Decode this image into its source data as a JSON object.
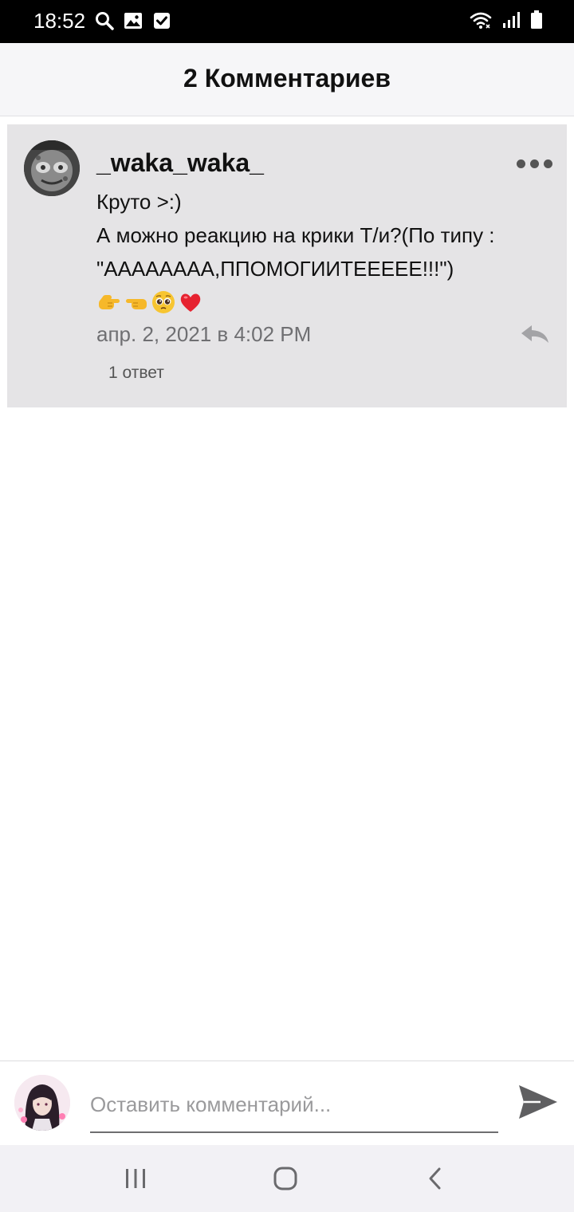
{
  "status_bar": {
    "time": "18:52",
    "left_icons": [
      "search-icon",
      "image-icon",
      "checkbox-icon"
    ],
    "right_icons": [
      "wifi-icon",
      "signal-icon",
      "battery-icon"
    ]
  },
  "header": {
    "title": "2 Комментариев"
  },
  "comments": [
    {
      "username": "_waka_waka_",
      "lines": [
        "Круто >:)",
        "А можно реакцию на крики Т/и?(По типу :",
        "\"АААААААА,ППОМОГИИТЕЕЕЕЕ!!!\")"
      ],
      "emoji": [
        "point-right-emoji",
        "point-left-emoji",
        "pleading-face-emoji",
        "red-heart-emoji"
      ],
      "date": "апр. 2, 2021 в 4:02 PM",
      "replies_label": "1 ответ"
    }
  ],
  "composer": {
    "placeholder": "Оставить комментарий..."
  },
  "colors": {
    "card_bg": "#e5e4e6",
    "header_bg": "#f6f6f8",
    "status_bg": "#000000"
  }
}
